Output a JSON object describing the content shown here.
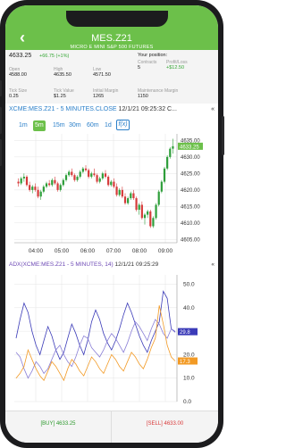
{
  "header": {
    "title": "MES.Z21",
    "subtitle": "MICRO E MINI S&P 500 FUTURES",
    "back_icon": "chevron-left-icon"
  },
  "quote": {
    "last": "4633.25",
    "change": "+66.75 (+1%)",
    "open_label": "Open",
    "open": "4588.00",
    "high_label": "High",
    "high": "4635.50",
    "low_label": "Low",
    "low": "4571.50",
    "tick_size_label": "Tick Size",
    "tick_size": "0.25",
    "tick_value_label": "Tick Value",
    "tick_value": "$1.25",
    "initial_margin_label": "Initial Margin",
    "initial_margin": "1265",
    "maintenance_margin_label": "Maintenance Margin",
    "maintenance_margin": "1150"
  },
  "position": {
    "title": "Your position:",
    "contracts_label": "Contracts",
    "contracts": "5",
    "pnl_label": "Profit/Loss",
    "pnl": "+$12.50"
  },
  "price_chart": {
    "header": "XCME:MES.Z21 - 5 MINUTES.CLOSE",
    "timestamp": "12/1/21 09:25:32 C...",
    "collapse_icon": "double-chevron-left-icon",
    "timeframes": [
      "1m",
      "5m",
      "15m",
      "30m",
      "60m",
      "1d"
    ],
    "active_timeframe": "5m",
    "fx_label": "f(x)",
    "current_price_label": "4633.25"
  },
  "adx_chart": {
    "header": "ADX(XCME:MES.Z21 - 5 MINUTES, 14)",
    "timestamp": "12/1/21 09:25:29",
    "collapse_icon": "double-chevron-left-icon",
    "marker_values": [
      "29.8",
      "17.3"
    ]
  },
  "chart_data": [
    {
      "type": "candlestick",
      "x_ticks": [
        "04:00",
        "05:00",
        "06:00",
        "07:00",
        "08:00",
        "09:00"
      ],
      "y_ticks": [
        "4605.00",
        "4610.00",
        "4615.00",
        "4620.00",
        "4625.00",
        "4630.00",
        "4635.00"
      ],
      "ylim": [
        4604,
        4637
      ],
      "candles": [
        [
          4622.5,
          4623.5,
          4621.0,
          4622.0
        ],
        [
          4622.0,
          4624.0,
          4621.5,
          4623.5
        ],
        [
          4623.5,
          4625.0,
          4622.5,
          4624.0
        ],
        [
          4624.0,
          4624.5,
          4621.0,
          4621.5
        ],
        [
          4621.5,
          4622.5,
          4619.5,
          4620.0
        ],
        [
          4620.0,
          4621.5,
          4619.0,
          4621.0
        ],
        [
          4621.0,
          4622.0,
          4619.5,
          4620.0
        ],
        [
          4620.0,
          4621.0,
          4617.5,
          4618.0
        ],
        [
          4618.0,
          4620.0,
          4617.0,
          4619.5
        ],
        [
          4619.5,
          4621.5,
          4619.0,
          4621.0
        ],
        [
          4621.0,
          4622.5,
          4620.5,
          4622.0
        ],
        [
          4622.0,
          4623.0,
          4621.0,
          4621.5
        ],
        [
          4621.5,
          4623.5,
          4621.0,
          4623.0
        ],
        [
          4623.0,
          4624.0,
          4621.5,
          4622.0
        ],
        [
          4622.0,
          4622.5,
          4619.5,
          4620.0
        ],
        [
          4620.0,
          4622.0,
          4619.5,
          4621.5
        ],
        [
          4621.5,
          4623.5,
          4621.0,
          4623.0
        ],
        [
          4623.0,
          4625.0,
          4622.5,
          4624.5
        ],
        [
          4624.5,
          4626.0,
          4624.0,
          4625.5
        ],
        [
          4625.5,
          4626.5,
          4624.0,
          4624.5
        ],
        [
          4624.5,
          4625.0,
          4622.5,
          4623.0
        ],
        [
          4623.0,
          4624.5,
          4622.5,
          4624.0
        ],
        [
          4624.0,
          4626.0,
          4623.5,
          4625.5
        ],
        [
          4625.5,
          4627.0,
          4625.0,
          4626.5
        ],
        [
          4626.5,
          4627.5,
          4625.5,
          4626.0
        ],
        [
          4626.0,
          4626.5,
          4623.5,
          4624.0
        ],
        [
          4624.0,
          4625.5,
          4623.5,
          4625.0
        ],
        [
          4625.0,
          4626.5,
          4624.0,
          4624.5
        ],
        [
          4624.5,
          4625.0,
          4622.0,
          4622.5
        ],
        [
          4622.5,
          4624.0,
          4622.0,
          4623.5
        ],
        [
          4623.5,
          4625.5,
          4623.0,
          4625.0
        ],
        [
          4625.0,
          4626.0,
          4623.5,
          4624.0
        ],
        [
          4624.0,
          4624.5,
          4621.0,
          4621.5
        ],
        [
          4621.5,
          4623.0,
          4621.0,
          4622.5
        ],
        [
          4622.5,
          4623.5,
          4620.5,
          4621.0
        ],
        [
          4621.0,
          4622.0,
          4618.0,
          4618.5
        ],
        [
          4618.5,
          4620.5,
          4618.0,
          4620.0
        ],
        [
          4620.0,
          4621.0,
          4617.5,
          4618.0
        ],
        [
          4618.0,
          4619.0,
          4615.5,
          4616.0
        ],
        [
          4616.0,
          4618.0,
          4615.5,
          4617.5
        ],
        [
          4617.5,
          4619.5,
          4617.0,
          4619.0
        ],
        [
          4619.0,
          4620.0,
          4617.0,
          4617.5
        ],
        [
          4617.5,
          4618.0,
          4613.5,
          4614.0
        ],
        [
          4614.0,
          4616.0,
          4612.5,
          4615.5
        ],
        [
          4615.5,
          4616.5,
          4611.0,
          4611.5
        ],
        [
          4611.5,
          4613.0,
          4609.5,
          4612.5
        ],
        [
          4612.5,
          4614.0,
          4611.5,
          4613.5
        ],
        [
          4613.5,
          4614.0,
          4608.5,
          4609.0
        ],
        [
          4609.0,
          4612.0,
          4608.5,
          4611.5
        ],
        [
          4611.5,
          4616.0,
          4611.0,
          4615.5
        ],
        [
          4615.5,
          4620.0,
          4615.0,
          4619.5
        ],
        [
          4619.5,
          4623.0,
          4619.0,
          4622.5
        ],
        [
          4622.5,
          4627.0,
          4622.0,
          4626.5
        ],
        [
          4626.5,
          4630.5,
          4626.0,
          4630.0
        ],
        [
          4630.0,
          4633.0,
          4629.5,
          4632.5
        ],
        [
          4632.5,
          4635.5,
          4631.0,
          4633.25
        ]
      ]
    },
    {
      "type": "line",
      "x_ticks": [
        "04:00",
        "05:00",
        "06:00",
        "07:00",
        "08:00",
        "09:00"
      ],
      "y_ticks": [
        "0.0",
        "10.0",
        "20.0",
        "30.0",
        "40.0",
        "50.0"
      ],
      "ylim": [
        0,
        54
      ],
      "series": [
        {
          "color": "#3b3bb8",
          "values": [
            27,
            35,
            42,
            38,
            30,
            24,
            20,
            26,
            32,
            28,
            22,
            18,
            21,
            27,
            33,
            29,
            24,
            20,
            26,
            34,
            39,
            35,
            29,
            25,
            22,
            26,
            31,
            37,
            42,
            38,
            33,
            28,
            24,
            21,
            26,
            30,
            34,
            47,
            44,
            31,
            29.8
          ]
        },
        {
          "color": "#8a7fd6",
          "values": [
            21,
            19,
            14,
            10,
            13,
            17,
            15,
            12,
            14,
            18,
            22,
            24,
            20,
            17,
            15,
            19,
            24,
            28,
            27,
            23,
            21,
            19,
            22,
            26,
            29,
            27,
            24,
            21,
            25,
            30,
            34,
            32,
            29,
            26,
            31,
            35,
            33,
            29,
            27,
            31,
            29.5
          ]
        },
        {
          "color": "#f29a25",
          "values": [
            10,
            12,
            15,
            22,
            18,
            14,
            11,
            9,
            13,
            17,
            15,
            12,
            9,
            14,
            18,
            16,
            13,
            11,
            15,
            19,
            17,
            14,
            12,
            16,
            20,
            18,
            15,
            13,
            17,
            21,
            19,
            16,
            14,
            18,
            23,
            27,
            41,
            33,
            24,
            19,
            17.3
          ]
        }
      ]
    }
  ],
  "footer": {
    "buy_label": "[BUY] 4633.25",
    "sell_label": "[SELL] 4633.00"
  },
  "colors": {
    "brand_green": "#6cc04a",
    "up_candle": "#2e9e3a",
    "down_candle": "#d63b3b",
    "adx_line": "#3b3bb8",
    "plus_di_line": "#8a7fd6",
    "minus_di_line": "#f29a25"
  }
}
